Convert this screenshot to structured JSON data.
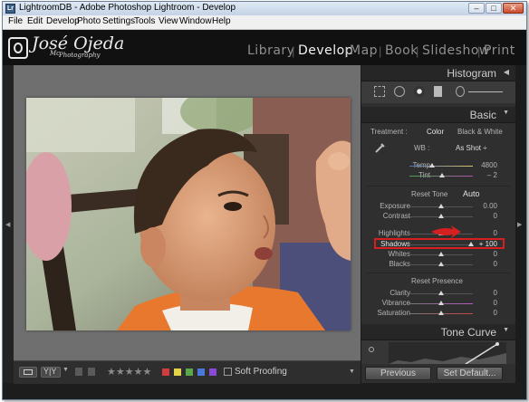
{
  "titlebar": {
    "title": "LightroomDB - Adobe Photoshop Lightroom - Develop",
    "app_icon": "Lr"
  },
  "menu": [
    "File",
    "Edit",
    "Develop",
    "Photo",
    "Settings",
    "Tools",
    "View",
    "Window",
    "Help"
  ],
  "identity_plate": {
    "name": "José Ojeda",
    "sub": "Photography",
    "prefix": "Mc"
  },
  "modules": [
    "Library",
    "Develop",
    "Map",
    "Book",
    "Slideshow",
    "Print"
  ],
  "active_module": "Develop",
  "toolbar": {
    "view_icon": "loupe-icon",
    "compare": "Y|Y",
    "stars": "★★★★★",
    "soft_proofing": "Soft Proofing",
    "colors": [
      "#d23c3c",
      "#e2d34a",
      "#5aa84a",
      "#4a7ad8",
      "#8a4ad8"
    ]
  },
  "panels": {
    "histogram": "Histogram",
    "basic": "Basic",
    "tone_curve": "Tone Curve"
  },
  "basic": {
    "treatment_label": "Treatment :",
    "treatment_color": "Color",
    "treatment_bw": "Black & White",
    "wb_label": "WB :",
    "wb_value": "As Shot ÷",
    "temp": {
      "label": "Temp",
      "value": "4800"
    },
    "tint": {
      "label": "Tint",
      "value": "– 2"
    },
    "reset_tone": "Reset Tone",
    "auto": "Auto",
    "exposure": {
      "label": "Exposure",
      "value": "0.00"
    },
    "contrast": {
      "label": "Contrast",
      "value": "0"
    },
    "highlights": {
      "label": "Highlights",
      "value": "0"
    },
    "shadows": {
      "label": "Shadows",
      "value": "+ 100"
    },
    "whites": {
      "label": "Whites",
      "value": "0"
    },
    "blacks": {
      "label": "Blacks",
      "value": "0"
    },
    "reset_presence": "Reset Presence",
    "clarity": {
      "label": "Clarity",
      "value": "0"
    },
    "vibrance": {
      "label": "Vibrance",
      "value": "0"
    },
    "saturation": {
      "label": "Saturation",
      "value": "0"
    }
  },
  "buttons": {
    "previous": "Previous",
    "set_default": "Set Default..."
  }
}
